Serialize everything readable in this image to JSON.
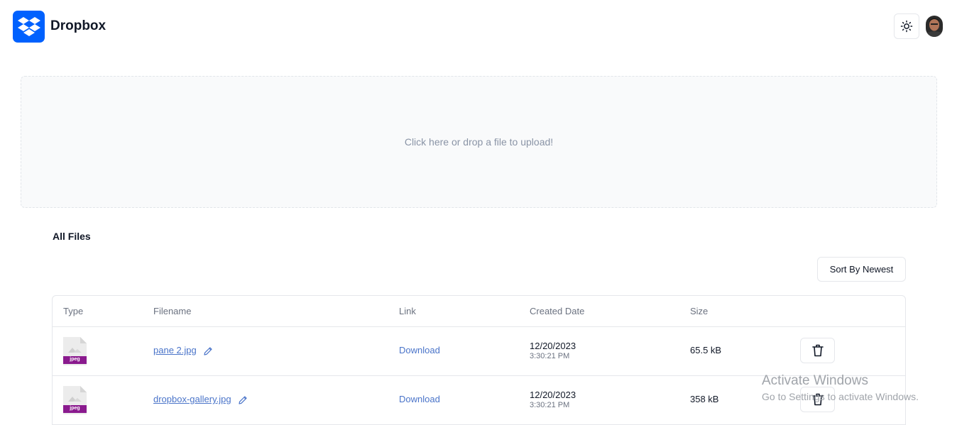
{
  "header": {
    "brand": "Dropbox",
    "logo_icon": "dropbox-logo-icon",
    "theme_icon": "sun-icon",
    "brand_color": "#0061fe"
  },
  "dropzone": {
    "text": "Click here or drop a file to upload!"
  },
  "files": {
    "title": "All Files",
    "sort_label": "Sort By Newest",
    "columns": [
      "Type",
      "Filename",
      "Link",
      "Created Date",
      "Size"
    ],
    "rows": [
      {
        "type_label": "jpeg",
        "filename": "pane 2.jpg",
        "link": "Download",
        "date": "12/20/2023",
        "time": "3:30:21 PM",
        "size": "65.5 kB"
      },
      {
        "type_label": "jpeg",
        "filename": "dropbox-gallery.jpg",
        "link": "Download",
        "date": "12/20/2023",
        "time": "3:30:21 PM",
        "size": "358 kB"
      }
    ]
  },
  "watermark": {
    "line1": "Activate Windows",
    "line2": "Go to Settings to activate Windows."
  }
}
